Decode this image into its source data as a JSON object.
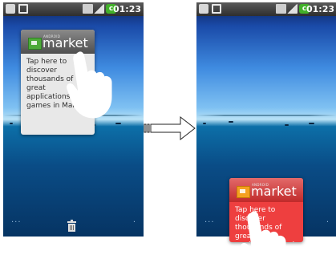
{
  "left_screen": {
    "status_bar": {
      "icons": [
        "usb-icon",
        "sd-card-icon",
        "network-icon",
        "signal-icon",
        "battery-icon"
      ],
      "clock": "01:23"
    },
    "widget": {
      "sublabel": "ANDROID",
      "name": "market",
      "description": "Tap here to discover thousands of great applications and games in Market."
    },
    "dock": {
      "left": "···",
      "right": "·"
    }
  },
  "right_screen": {
    "status_bar": {
      "icons": [
        "usb-icon",
        "sd-card-icon",
        "network-icon",
        "signal-icon",
        "battery-icon"
      ],
      "clock": "01:23"
    },
    "widget": {
      "sublabel": "ANDROID",
      "name": "market",
      "description": "Tap here to discover thousands of great applications and games in Market."
    },
    "dock": {
      "left": "···",
      "right": "·"
    }
  },
  "colors": {
    "widget_gray": "#e8e8e8",
    "widget_red": "#ee3f3f",
    "battery_green": "#42b12a",
    "market_logo_green": "#4caa38"
  }
}
